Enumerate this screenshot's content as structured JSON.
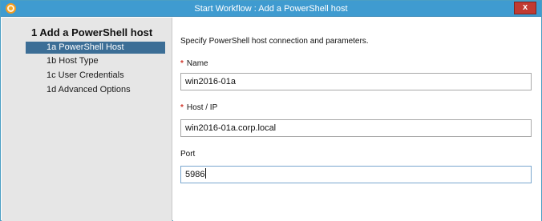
{
  "window": {
    "title": "Start Workflow : Add a PowerShell host",
    "app_icon": "vrealize-orchestrator-icon",
    "close_glyph": "x"
  },
  "sidebar": {
    "step_title": "1 Add a PowerShell host",
    "items": [
      {
        "label": "1a  PowerShell Host",
        "selected": true
      },
      {
        "label": "1b  Host Type",
        "selected": false
      },
      {
        "label": "1c  User Credentials",
        "selected": false
      },
      {
        "label": "1d  Advanced Options",
        "selected": false
      }
    ]
  },
  "form": {
    "intro": "Specify PowerShell host connection and parameters.",
    "required_mark": "*",
    "fields": [
      {
        "label": "Name",
        "required": true,
        "value": "win2016-01a"
      },
      {
        "label": "Host / IP",
        "required": true,
        "value": "win2016-01a.corp.local"
      },
      {
        "label": "Port",
        "required": false,
        "value": "5986",
        "focused": true
      }
    ]
  },
  "colors": {
    "titlebar": "#3f9bd0",
    "selected_step": "#3c6e96",
    "required": "#d13a2f",
    "close": "#c13a32"
  }
}
